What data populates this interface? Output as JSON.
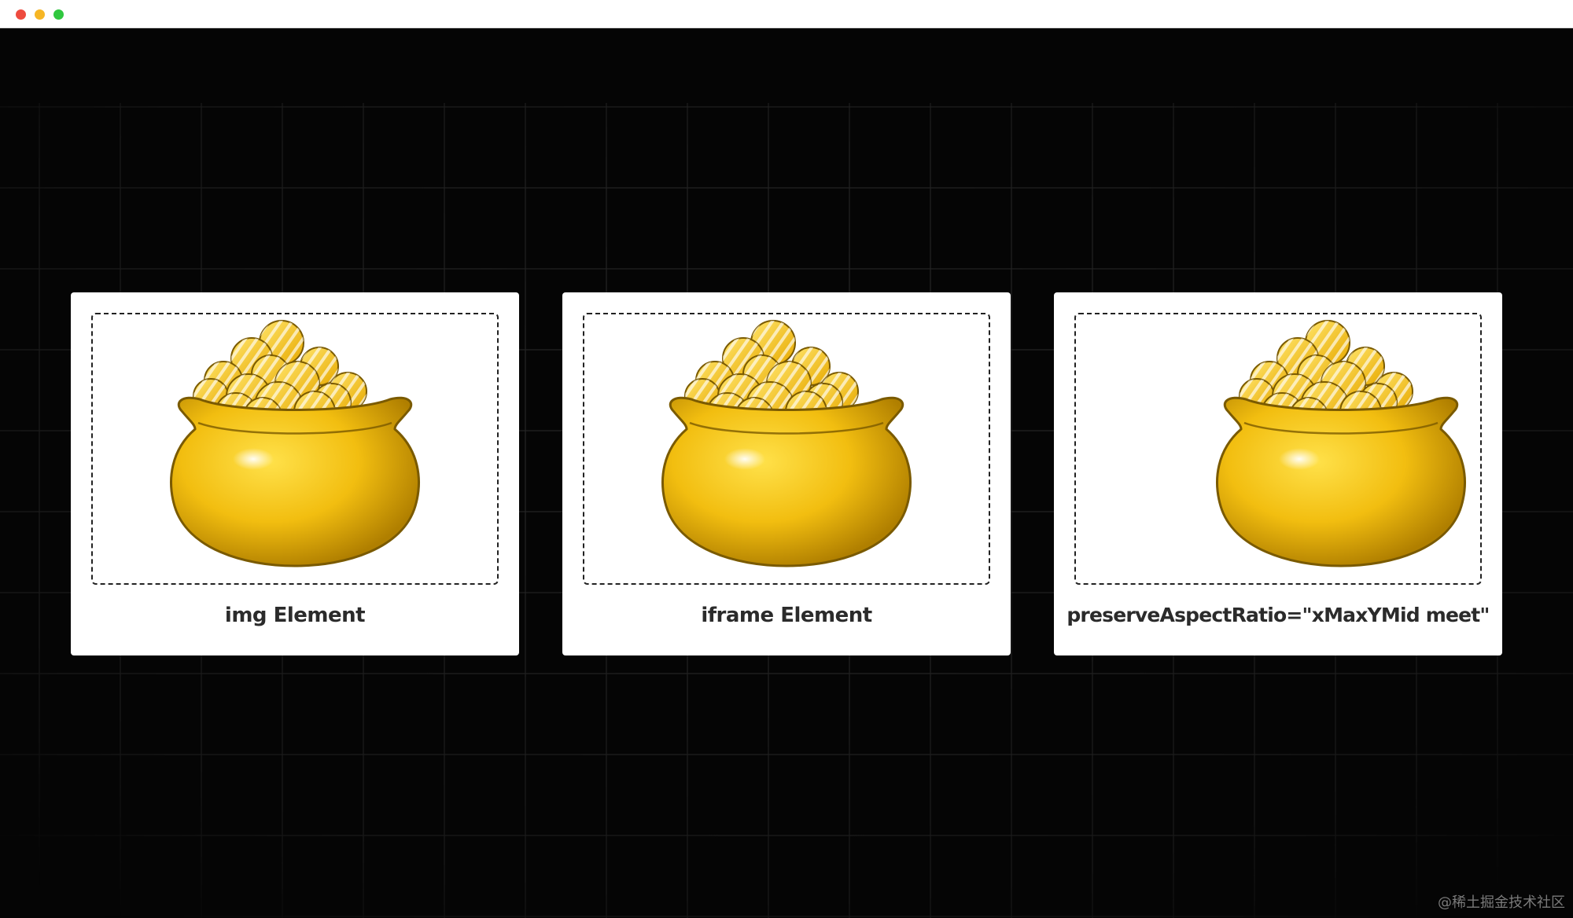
{
  "window": {
    "controls": [
      "close",
      "minimize",
      "maximize"
    ]
  },
  "colors": {
    "background": "#050505",
    "grid": "#2a2a2a",
    "card": "#ffffff",
    "gold_light": "#ffe14a",
    "gold_mid": "#f2be10",
    "gold_dark": "#b07f00",
    "outline": "#7a5a00"
  },
  "cards": [
    {
      "caption": "img Element",
      "icon": "gold-pot-icon"
    },
    {
      "caption": "iframe Element",
      "icon": "gold-pot-icon"
    },
    {
      "caption": "preserveAspectRatio=\"xMaxYMid meet\"",
      "icon": "gold-pot-icon"
    }
  ],
  "watermark": "@稀土掘金技术社区"
}
